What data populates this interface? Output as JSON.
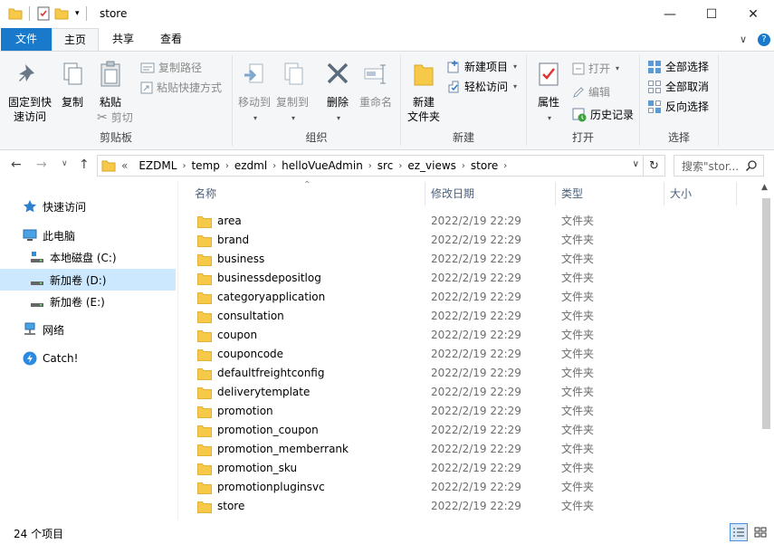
{
  "window": {
    "title": "store",
    "controls": {
      "minimize": "—",
      "maximize": "☐",
      "close": "✕"
    }
  },
  "ribbon_tabs": [
    {
      "label": "文件"
    },
    {
      "label": "主页"
    },
    {
      "label": "共享"
    },
    {
      "label": "查看"
    }
  ],
  "ribbon_help": {
    "collapse": "∨",
    "help": "?"
  },
  "ribbon": {
    "clipboard": {
      "label": "剪贴板",
      "pin": "固定到快\n速访问",
      "copy": "复制",
      "paste": "粘贴",
      "copy_path": "复制路径",
      "paste_shortcut": "粘贴快捷方式",
      "cut": "剪切"
    },
    "organize": {
      "label": "组织",
      "move_to": "移动到",
      "copy_to": "复制到",
      "delete": "删除",
      "rename": "重命名"
    },
    "new": {
      "label": "新建",
      "new_folder": "新建\n文件夹",
      "new_item": "新建项目",
      "easy_access": "轻松访问"
    },
    "open": {
      "label": "打开",
      "properties": "属性",
      "open": "打开",
      "edit": "编辑",
      "history": "历史记录"
    },
    "select": {
      "label": "选择",
      "select_all": "全部选择",
      "select_none": "全部取消",
      "invert": "反向选择"
    }
  },
  "address": {
    "overflow": "«",
    "crumbs": [
      "EZDML",
      "temp",
      "ezdml",
      "helloVueAdmin",
      "src",
      "ez_views",
      "store"
    ],
    "search_placeholder": "搜索\"stor...",
    "refresh": "↻"
  },
  "nav": {
    "back": "←",
    "forward": "→",
    "recent": "∨",
    "up": "↑",
    "items": [
      {
        "label": "快速访问",
        "icon": "star-icon"
      },
      {
        "label": "此电脑",
        "icon": "computer-icon"
      },
      {
        "label": "本地磁盘 (C:)",
        "icon": "drive-icon"
      },
      {
        "label": "新加卷 (D:)",
        "icon": "drive-icon",
        "selected": true
      },
      {
        "label": "新加卷 (E:)",
        "icon": "drive-icon"
      },
      {
        "label": "网络",
        "icon": "network-icon"
      },
      {
        "label": "Catch!",
        "icon": "catch-icon"
      }
    ]
  },
  "columns": {
    "name": "名称",
    "date": "修改日期",
    "type": "类型",
    "size": "大小"
  },
  "files": [
    {
      "name": "area",
      "date": "2022/2/19 22:29",
      "type": "文件夹"
    },
    {
      "name": "brand",
      "date": "2022/2/19 22:29",
      "type": "文件夹"
    },
    {
      "name": "business",
      "date": "2022/2/19 22:29",
      "type": "文件夹"
    },
    {
      "name": "businessdepositlog",
      "date": "2022/2/19 22:29",
      "type": "文件夹"
    },
    {
      "name": "categoryapplication",
      "date": "2022/2/19 22:29",
      "type": "文件夹"
    },
    {
      "name": "consultation",
      "date": "2022/2/19 22:29",
      "type": "文件夹"
    },
    {
      "name": "coupon",
      "date": "2022/2/19 22:29",
      "type": "文件夹"
    },
    {
      "name": "couponcode",
      "date": "2022/2/19 22:29",
      "type": "文件夹"
    },
    {
      "name": "defaultfreightconfig",
      "date": "2022/2/19 22:29",
      "type": "文件夹"
    },
    {
      "name": "deliverytemplate",
      "date": "2022/2/19 22:29",
      "type": "文件夹"
    },
    {
      "name": "promotion",
      "date": "2022/2/19 22:29",
      "type": "文件夹"
    },
    {
      "name": "promotion_coupon",
      "date": "2022/2/19 22:29",
      "type": "文件夹"
    },
    {
      "name": "promotion_memberrank",
      "date": "2022/2/19 22:29",
      "type": "文件夹"
    },
    {
      "name": "promotion_sku",
      "date": "2022/2/19 22:29",
      "type": "文件夹"
    },
    {
      "name": "promotionpluginsvc",
      "date": "2022/2/19 22:29",
      "type": "文件夹"
    },
    {
      "name": "store",
      "date": "2022/2/19 22:29",
      "type": "文件夹"
    }
  ],
  "status": {
    "item_count": "24 个项目"
  },
  "colors": {
    "accent": "#1979ca",
    "folder": "#f7c948",
    "selection": "#cce8ff",
    "header_text": "#4c607a"
  }
}
